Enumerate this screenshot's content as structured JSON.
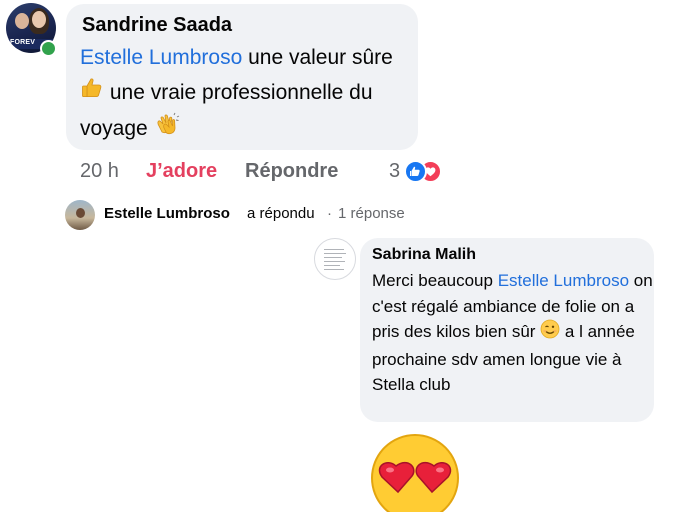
{
  "comment": {
    "author": "Sandrine Saada",
    "avatar_banner": "FOREV",
    "mention": "Estelle Lumbroso",
    "text_part1": " une valeur sûre ",
    "emoji1": "thumbs-up",
    "text_part2": " une vraie professionnelle du voyage ",
    "emoji2": "clapping-hands",
    "time": "20 h",
    "love_label": "J’adore",
    "reply_label": "Répondre",
    "reaction_count": "3",
    "reactions": [
      "like-icon",
      "heart-icon"
    ]
  },
  "replies_summary": {
    "name": "Estelle Lumbroso",
    "verb": "a répondu",
    "separator": "·",
    "count": "1 réponse"
  },
  "reply": {
    "author": "Sabrina Malih",
    "text_part1": "Merci beaucoup ",
    "mention": "Estelle Lumbroso",
    "text_part2": " on c'est régalé ambiance de folie on a pris des kilos bien sûr ",
    "emoji": "winking-face",
    "text_part3": " a l année prochaine sdv amen longue vie à Stella club"
  },
  "sticker": "heart-eyes-emoji",
  "colors": {
    "mention": "#216fdb",
    "love": "#e4405f",
    "bubble": "#f0f2f5",
    "online": "#31a24c",
    "like": "#1877f2",
    "heart": "#f33e58"
  }
}
